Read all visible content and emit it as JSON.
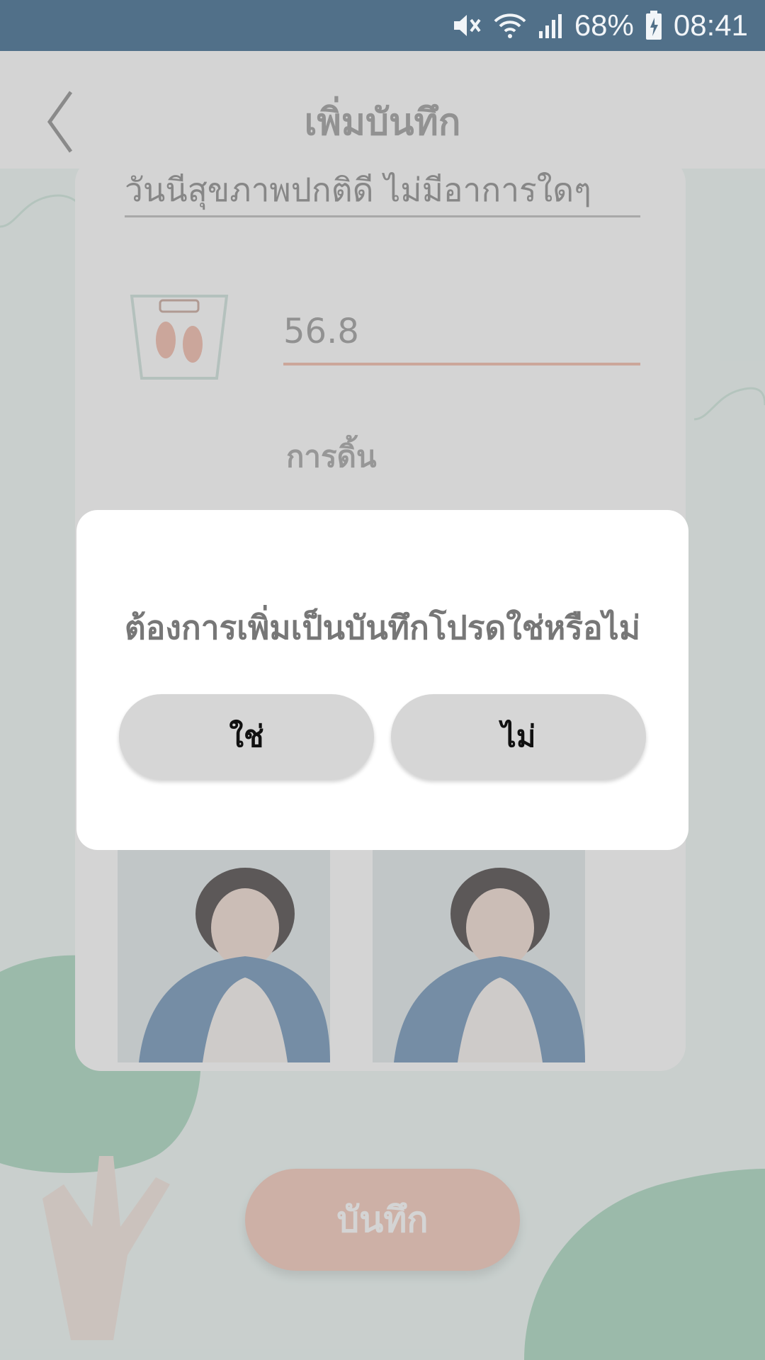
{
  "status_bar": {
    "battery": "68%",
    "time": "08:41",
    "icons": [
      "mute-icon",
      "wifi-icon",
      "signal-icon",
      "battery-charging-icon"
    ]
  },
  "header": {
    "title": "เพิ่มบันทึก",
    "back_icon": "chevron-left-icon"
  },
  "form": {
    "note_value": "วันนีสุขภาพปกติดี ไม่มีอาการใดๆ",
    "weight_value": "56.8",
    "weight_icon": "scale-icon",
    "kick_label": "การดิ้น"
  },
  "save_button": {
    "label": "บันทึก"
  },
  "dialog": {
    "message": "ต้องการเพิ่มเป็นบันทึกโปรดใช่หรือไม่",
    "yes_label": "ใช่",
    "no_label": "ไม่"
  },
  "colors": {
    "status_bar": "#517089",
    "accent": "#f4c8b9",
    "tree_green": "#a9d8bf"
  }
}
